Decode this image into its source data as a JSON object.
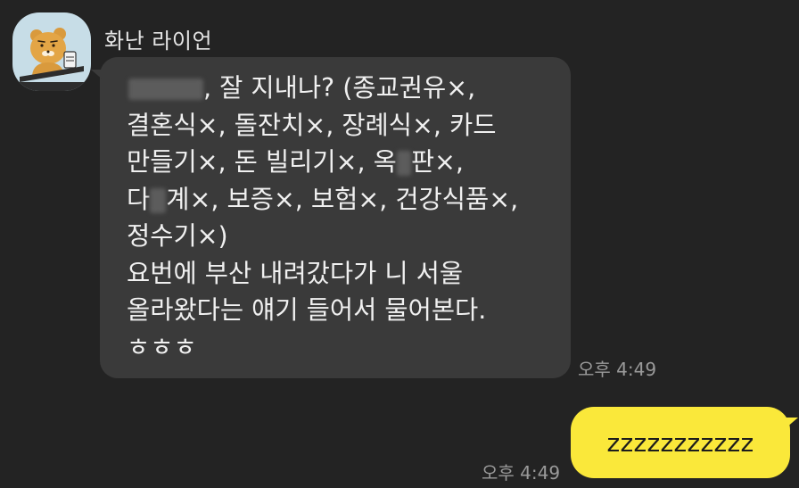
{
  "conversation": {
    "sender_name": "화난 라이언",
    "incoming": {
      "lines": [
        ", 잘 지내나? (종교권유×,",
        "결혼식×, 돌잔치×, 장례식×, 카드",
        "만들기×, 돈 빌리기×, 옥",
        "판×,",
        "다",
        "계×, 보증×, 보험×, 건강식품×,",
        "정수기×)",
        "요번에 부산 내려갔다가 니 서울",
        "올라왔다는 얘기 들어서 물어본다.",
        "ㅎㅎㅎ"
      ],
      "time": "오후 4:49"
    },
    "outgoing": {
      "text": "zzzzzzzzzzz",
      "time": "오후 4:49"
    }
  },
  "colors": {
    "background": "#232323",
    "incoming_bubble": "#3a3a3a",
    "outgoing_bubble": "#fae83a",
    "avatar_background": "#c7dde7"
  },
  "icons": {
    "avatar": "ryan-lion-avatar-icon"
  }
}
